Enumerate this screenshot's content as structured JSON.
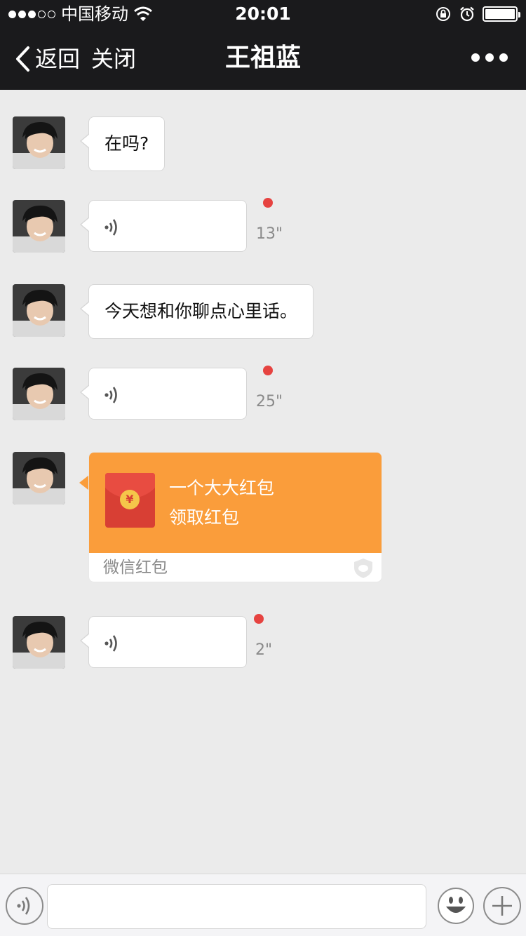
{
  "status_bar": {
    "carrier": "中国移动",
    "time": "20:01"
  },
  "nav": {
    "back_label": "返回",
    "close_label": "关闭",
    "title": "王祖蓝"
  },
  "messages": [
    {
      "type": "text",
      "text": "在吗?"
    },
    {
      "type": "voice",
      "duration": "13\"",
      "unread": true
    },
    {
      "type": "text",
      "text": "今天想和你聊点心里话。"
    },
    {
      "type": "voice",
      "duration": "25\"",
      "unread": true
    },
    {
      "type": "red_packet",
      "title": "一个大大红包",
      "action": "领取红包",
      "footer": "微信红包",
      "coin_symbol": "¥"
    },
    {
      "type": "voice",
      "duration": "2\"",
      "unread": true
    }
  ],
  "input_bar": {
    "text_value": ""
  },
  "colors": {
    "bar": "#1a1a1c",
    "background": "#ebebeb",
    "red_packet": "#fa9d3b",
    "unread_dot": "#e64340"
  }
}
